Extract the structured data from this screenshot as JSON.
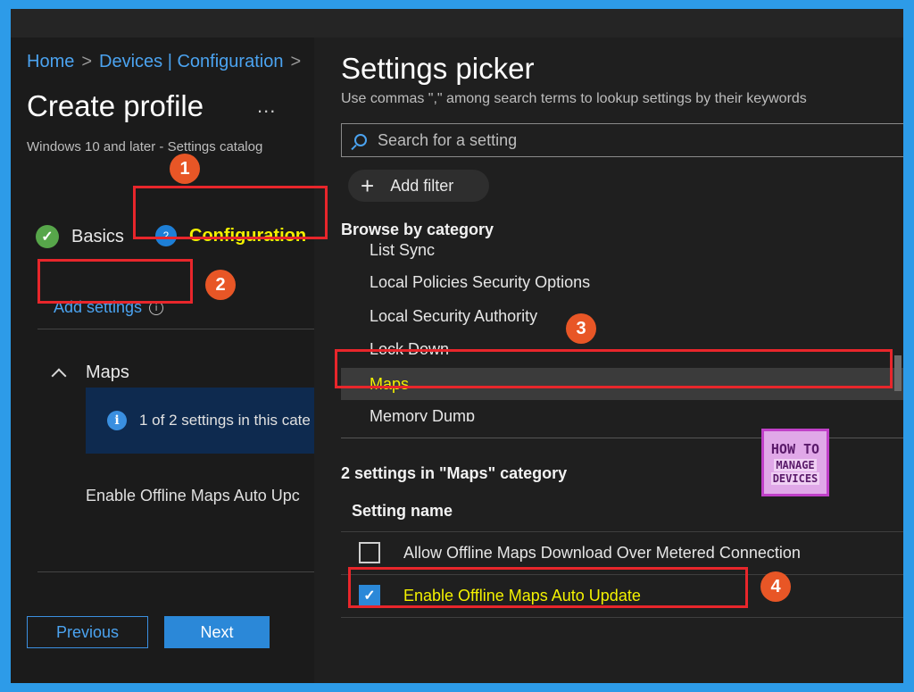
{
  "breadcrumb": {
    "home": "Home",
    "sep1": ">",
    "devices": "Devices | Configuration",
    "sep2": ">"
  },
  "page": {
    "title": "Create profile",
    "more": "...",
    "subtitle": "Windows 10 and later - Settings catalog"
  },
  "steps": [
    {
      "label": "Basics",
      "status": "complete"
    },
    {
      "number": "2",
      "label": "Configuration",
      "status": "current"
    }
  ],
  "add_settings": {
    "label": "Add settings",
    "info": "i"
  },
  "maps_section": {
    "title": "Maps",
    "info_text": "1 of 2 settings in this cate",
    "setting": "Enable Offline Maps Auto Upc"
  },
  "footer": {
    "previous": "Previous",
    "next": "Next"
  },
  "picker": {
    "title": "Settings picker",
    "hint": "Use commas \",\" among search terms to lookup settings by their keywords",
    "search_placeholder": "Search for a setting",
    "add_filter": "Add filter",
    "browse_label": "Browse by category",
    "categories": [
      "List Sync",
      "Local Policies Security Options",
      "Local Security Authority",
      "Lock Down",
      "Maps",
      "Memory Dump"
    ],
    "selected_category": "Maps",
    "count_label": "2 settings in \"Maps\" category",
    "column_header": "Setting name",
    "settings": [
      {
        "name": "Allow Offline Maps Download Over Metered Connection",
        "checked": false
      },
      {
        "name": "Enable Offline Maps Auto Update",
        "checked": true
      }
    ]
  },
  "annotations": {
    "b1": "1",
    "b2": "2",
    "b3": "3",
    "b4": "4"
  },
  "logo": {
    "line1": "HOW TO",
    "line2": "MANAGE",
    "line3": "DEVICES"
  },
  "colors": {
    "accent": "#2b88d8",
    "highlight": "#f3f100",
    "callout": "#e8262b",
    "badge": "#e85626"
  }
}
